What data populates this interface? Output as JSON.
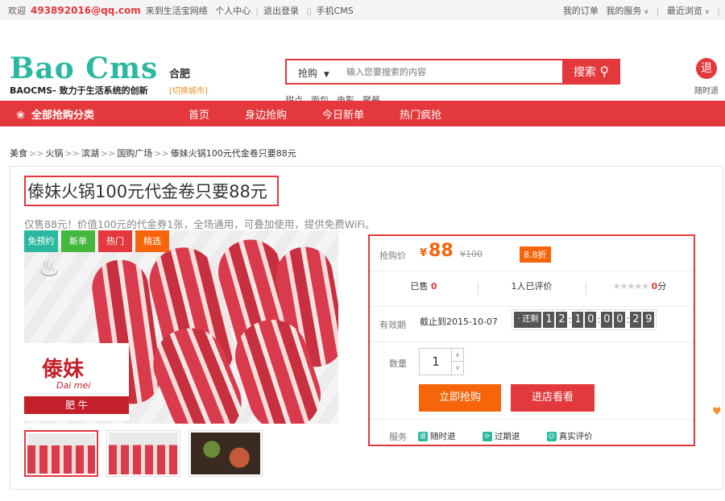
{
  "topbar": {
    "welcome": "欢迎",
    "email": "493892016@qq.com",
    "site": "来到生活宝网络",
    "user_center": "个人中心",
    "divider": "|",
    "logout": "退出登录",
    "mobile": "手机CMS",
    "orders": "我的订单",
    "services": "我的服务",
    "recent": "最近浏览"
  },
  "header": {
    "logo": "Bao Cms",
    "slogan": "BAOCMS- 致力于生活系统的创新",
    "city": "合肥",
    "city_switch": "[切换城市]",
    "search_category": "抢购",
    "search_placeholder": "输入您要搜索的内容",
    "search_button": "搜索",
    "hot_words": [
      "甜点",
      "面包",
      "电影",
      "聚餐"
    ],
    "refund_icon": "退",
    "refund_label": "随时退"
  },
  "nav": {
    "all_categories": "全部抢购分类",
    "items": [
      "首页",
      "身边抢购",
      "今日新单",
      "热门疯抢"
    ]
  },
  "breadcrumb": {
    "items": [
      "美食",
      "火锅",
      "滨湖",
      "国购广场",
      "傣妹火锅100元代金卷只要88元"
    ],
    "sep": ">>"
  },
  "product": {
    "title": "傣妹火锅100元代金卷只要88元",
    "subtitle": "仅售88元！价值100元的代金券1张，全场通用，可叠加使用，提供免费WiFi。",
    "badges": [
      "免预约",
      "新单",
      "热门",
      "精选"
    ],
    "brand_cn": "傣妹",
    "brand_en": "Dai mei",
    "brand_tag": "肥 牛"
  },
  "buybox": {
    "price_label": "抢购价",
    "currency": "¥",
    "price": "88",
    "original_price": "¥100",
    "discount": "8.8折",
    "sold_label": "已售",
    "sold_count": "0",
    "reviews": "1人已评价",
    "stars": "★★★★★",
    "score": "0",
    "score_unit": "分",
    "expire_label": "有效期",
    "expire_text": "截止到2015-10-07",
    "countdown_label": "· 还剩",
    "countdown": [
      "1",
      "2",
      "1",
      "0",
      "0",
      "0",
      "2",
      "9"
    ],
    "qty_label": "数量",
    "qty_value": "1",
    "buy_button": "立即抢购",
    "visit_button": "进店看看",
    "service_label": "服务",
    "services": [
      "随时退",
      "过期退",
      "真实评价"
    ]
  },
  "colors": {
    "brand_red": "#e4393c",
    "accent_orange": "#f7650a",
    "logo_teal": "#2bb8a0"
  }
}
